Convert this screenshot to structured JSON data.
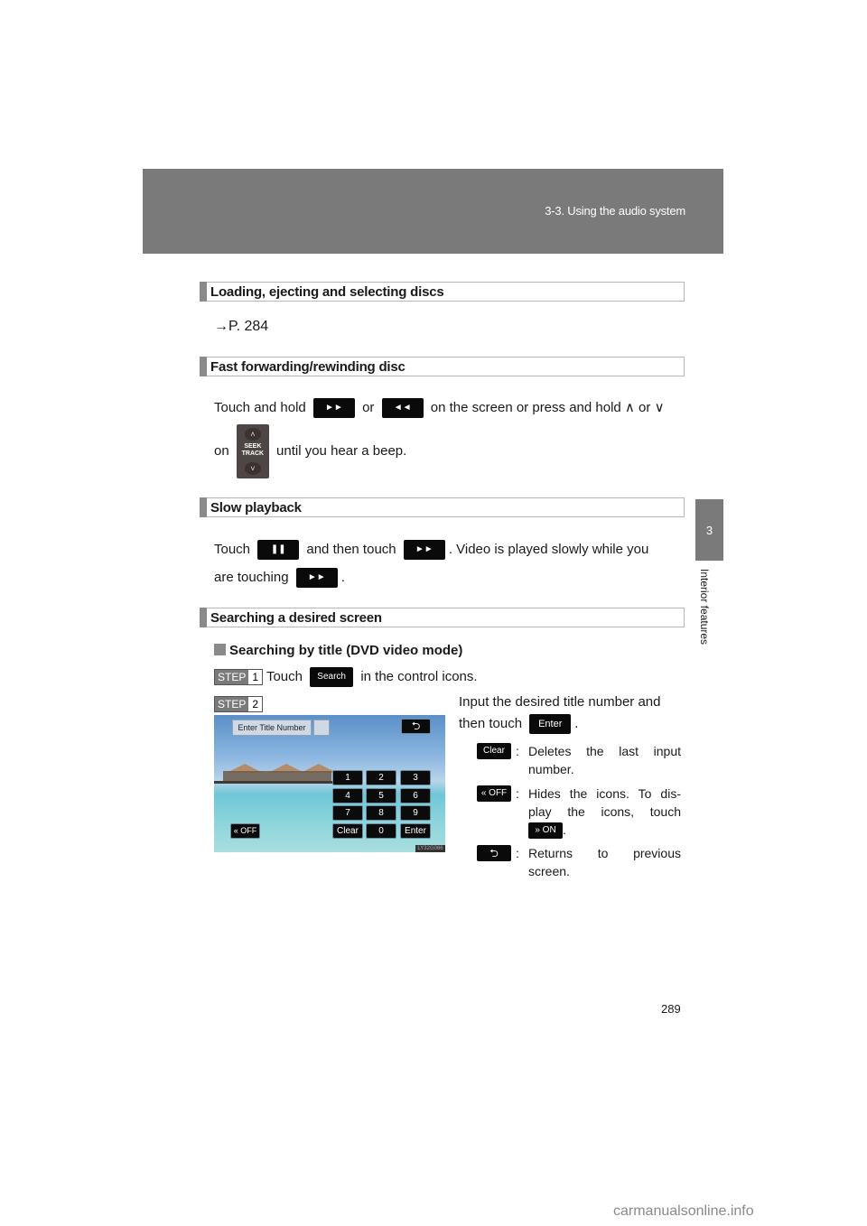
{
  "header": {
    "section_title": "3-3. Using the audio system"
  },
  "chapter_tab": {
    "number": "3",
    "label": "Interior features"
  },
  "sections": [
    {
      "heading": "Loading, ejecting and selecting discs",
      "ref": "→P. 284"
    },
    {
      "heading": "Fast forwarding/rewinding disc",
      "line1_a": "Touch and hold",
      "line1_b": "or",
      "line1_c": "on the screen or press and hold ∧ or ∨",
      "line2_a": "on",
      "line2_b": "until you hear a beep.",
      "ff_button": "►►",
      "rew_button": "◄◄",
      "seek_track": {
        "label_line1": "SEEK",
        "label_line2": "TRACK",
        "up": "˄",
        "down": "˅"
      }
    },
    {
      "heading": "Slow playback",
      "line1_a": "Touch",
      "line1_b": "and then touch",
      "line1_c": ". Video is played slowly while you",
      "line2_a": "are touching",
      "line2_b": ".",
      "pause_button": "❚❚",
      "ff_button": "►►"
    },
    {
      "heading": "Searching a desired screen",
      "subheading": "Searching by title (DVD video mode)",
      "step1": {
        "step_label": "STEP",
        "num": "1",
        "text_a": "Touch",
        "button": "Search",
        "text_b": "in the control icons."
      },
      "step2": {
        "step_label": "STEP",
        "num": "2",
        "instruction_a": "Input the desired title number and",
        "instruction_b": "then touch",
        "instruction_button": "Enter",
        "instruction_end": "."
      }
    }
  ],
  "screen": {
    "title_box": "Enter Title Number",
    "back_button": "⮌",
    "keys": [
      "1",
      "2",
      "3",
      "4",
      "5",
      "6",
      "7",
      "8",
      "9",
      "Clear",
      "0",
      "Enter"
    ],
    "off_button": "« OFF",
    "image_code": "LY32G066"
  },
  "legend": [
    {
      "icon": "Clear",
      "desc": "Deletes the last input number."
    },
    {
      "icon": "« OFF",
      "desc": "Hides the icons. To dis-play the icons, touch",
      "inline_icon": "» ON",
      "desc_end": "."
    },
    {
      "icon": "⮌",
      "desc": "Returns to previous screen."
    }
  ],
  "page_number": "289",
  "watermark": "carmanualsonline.info"
}
